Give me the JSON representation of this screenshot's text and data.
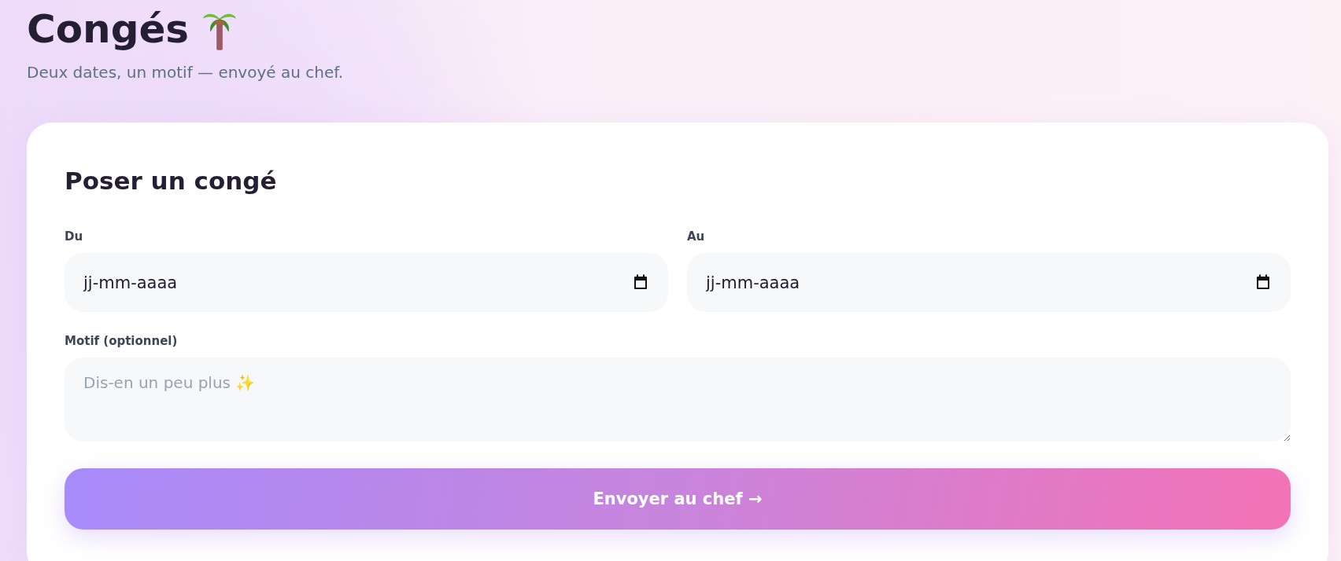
{
  "header": {
    "title": "Congés",
    "subtitle": "Deux dates, un motif — envoyé au chef."
  },
  "form": {
    "title": "Poser un congé",
    "dates": [
      {
        "label": "Du",
        "placeholder": "jj-mm-aaaa"
      },
      {
        "label": "Au",
        "placeholder": "jj-mm-aaaa"
      }
    ],
    "reason": {
      "label": "Motif (optionnel)",
      "placeholder": "Dis-en un peu plus ✨"
    },
    "submit": "Envoyer au chef →"
  }
}
